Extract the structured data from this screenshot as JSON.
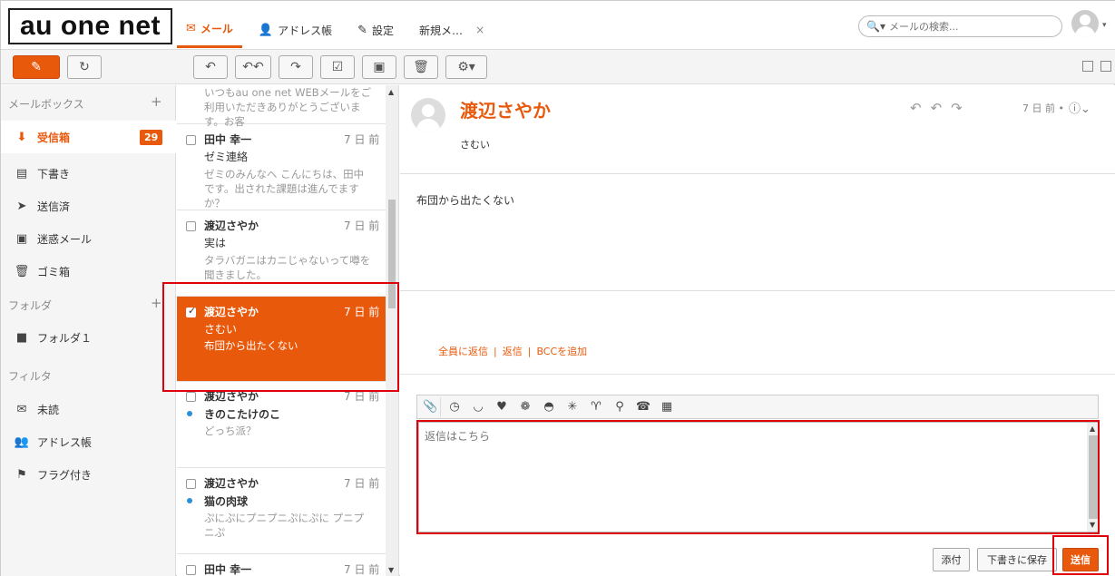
{
  "logo": {
    "text": "au one net"
  },
  "tabs": [
    {
      "icon": "mail-icon",
      "label": "メール",
      "active": true
    },
    {
      "icon": "address-book-icon",
      "label": "アドレス帳"
    },
    {
      "icon": "settings-icon",
      "label": "設定"
    },
    {
      "label": "新規メ…",
      "closable": true
    }
  ],
  "search": {
    "placeholder": "メールの検索..."
  },
  "sidebar": {
    "mailbox_header": "メールボックス",
    "items": [
      {
        "label": "受信箱",
        "badge": "29",
        "active": true
      },
      {
        "label": "下書き"
      },
      {
        "label": "送信済"
      },
      {
        "label": "迷惑メール"
      },
      {
        "label": "ゴミ箱"
      }
    ],
    "folder_header": "フォルダ",
    "folders": [
      {
        "label": "フォルダ１"
      }
    ],
    "filter_header": "フィルタ",
    "filters": [
      {
        "label": "未読"
      },
      {
        "label": "アドレス帳"
      },
      {
        "label": "フラグ付き"
      }
    ]
  },
  "messages": [
    {
      "from": "",
      "date": "",
      "subject": "",
      "preview": "いつもau one net WEBメールをご利用いただきありがとうございます。お客"
    },
    {
      "from": "田中 幸一",
      "date": "7 日 前",
      "subject": "ゼミ連絡",
      "preview": "ゼミのみんなへ こんにちは、田中です。出された課題は進んでますか？"
    },
    {
      "from": "渡辺さやか",
      "date": "7 日 前",
      "subject": "実は",
      "preview": "タラバガニはカニじゃないって噂を聞きました。"
    },
    {
      "from": "渡辺さやか",
      "date": "7 日 前",
      "subject": "さむい",
      "preview": "布団から出たくない",
      "selected": true
    },
    {
      "from": "渡辺さやか",
      "date": "7 日 前",
      "subject": "きのこたけのこ",
      "preview": "どっち派？",
      "unread": true
    },
    {
      "from": "渡辺さやか",
      "date": "7 日 前",
      "subject": "猫の肉球",
      "preview": "ぷにぷにプニプニぷにぷに プニプニぷ",
      "unread": true
    },
    {
      "from": "田中 幸一",
      "date": "7 日 前",
      "subject": "",
      "preview": ""
    }
  ],
  "reader": {
    "from": "渡辺さやか",
    "to": "さむい",
    "date": "7 日 前 •",
    "body": "布団から出たくない",
    "reply_all": "全員に返信",
    "reply": "返信",
    "add_bcc": "BCCを追加",
    "reply_placeholder": "返信はこちら",
    "attach": "添付",
    "save_draft": "下書きに保存",
    "send": "送信"
  },
  "colors": {
    "accent": "#e8590c",
    "highlight_box": "#e0000b",
    "unread_dot": "#2c8fd6"
  }
}
